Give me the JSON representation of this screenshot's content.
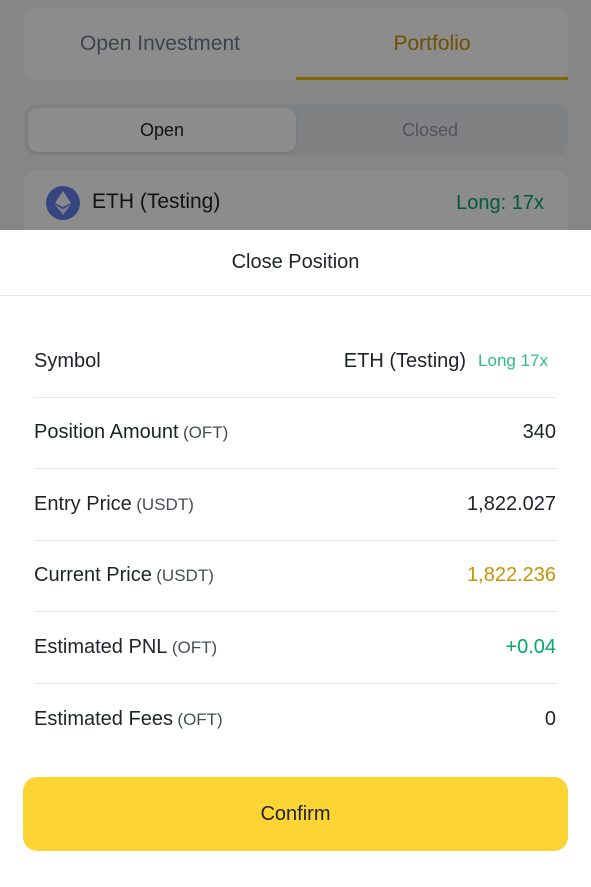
{
  "background": {
    "tabs": [
      {
        "label": "Open Investment",
        "active": false
      },
      {
        "label": "Portfolio",
        "active": true
      }
    ],
    "segments": [
      {
        "label": "Open",
        "active": true
      },
      {
        "label": "Closed",
        "active": false
      }
    ],
    "card": {
      "coin_icon": "eth-icon",
      "symbol": "ETH (Testing)",
      "side": "Long: 17x"
    }
  },
  "sheet": {
    "title": "Close Position",
    "rows": {
      "symbol": {
        "label": "Symbol",
        "value": "ETH (Testing)",
        "tag": "Long 17x"
      },
      "position_amount": {
        "label": "Position Amount",
        "unit": "(OFT)",
        "value": "340"
      },
      "entry_price": {
        "label": "Entry Price",
        "unit": "(USDT)",
        "value": "1,822.027"
      },
      "current_price": {
        "label": "Current Price",
        "unit": "(USDT)",
        "value": "1,822.236"
      },
      "estimated_pnl": {
        "label": "Estimated PNL",
        "unit": "(OFT)",
        "value": "+0.04"
      },
      "estimated_fees": {
        "label": "Estimated Fees",
        "unit": "(OFT)",
        "value": "0"
      }
    },
    "confirm_label": "Confirm"
  },
  "colors": {
    "accent_yellow": "#fcd535",
    "gold_text": "#c99400",
    "green": "#03a66d",
    "eth_blue": "#627eea"
  }
}
